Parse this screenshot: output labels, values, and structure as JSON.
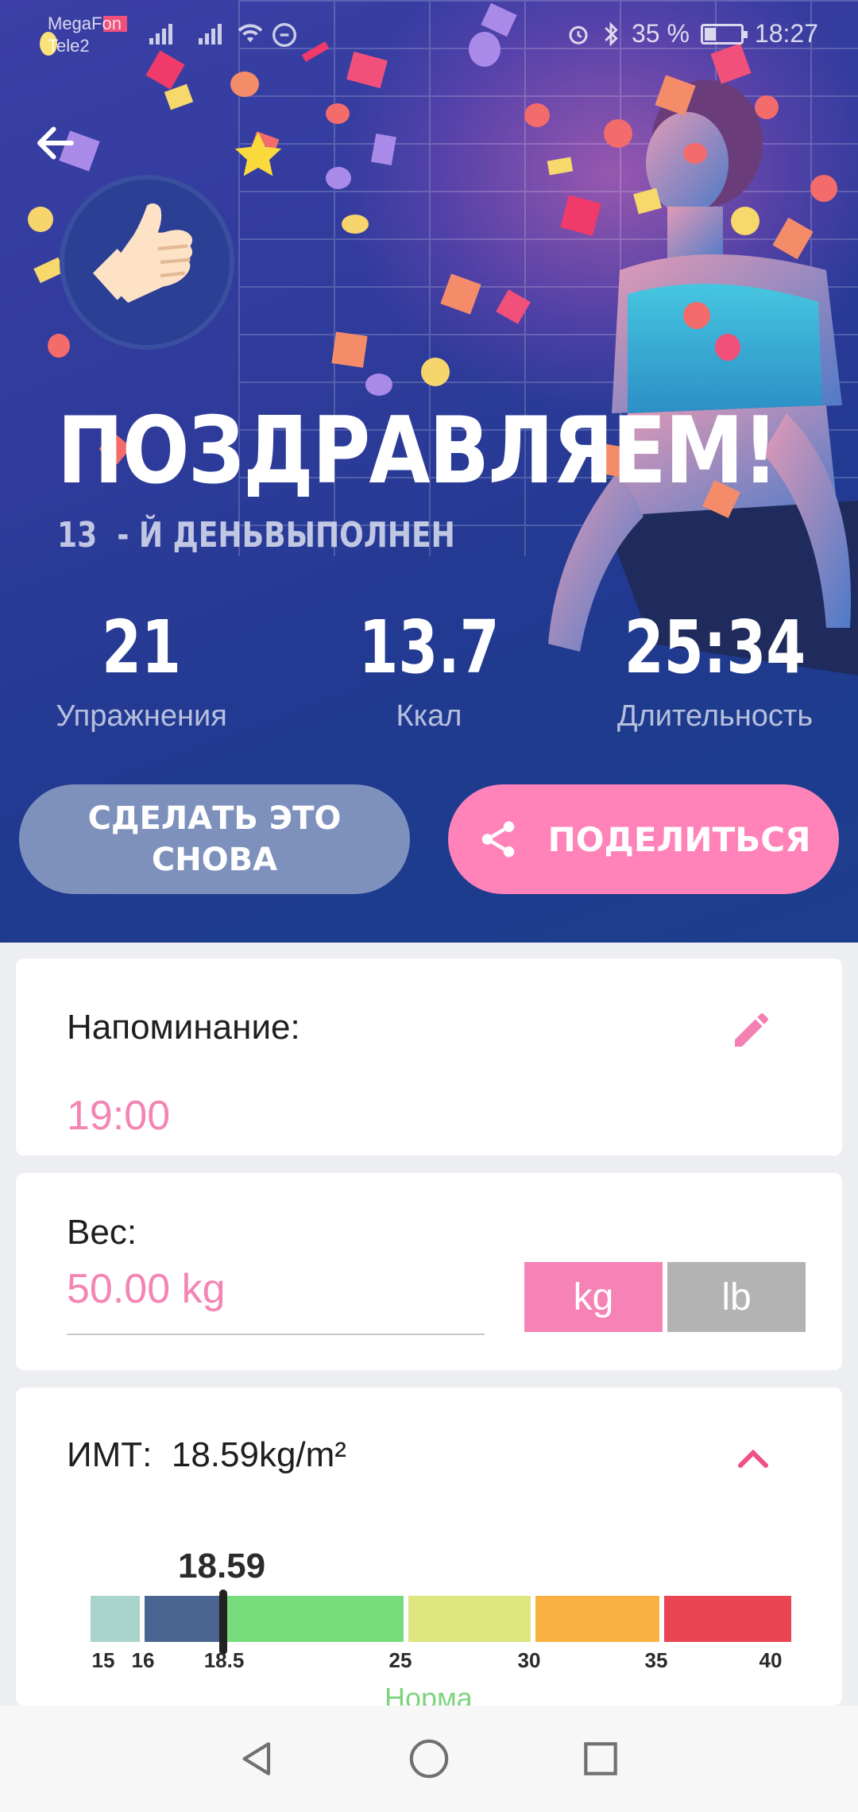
{
  "status_bar": {
    "carrier_1": "MegaFon",
    "carrier_2": "Tele2",
    "battery": "35 %",
    "time": "18:27"
  },
  "hero": {
    "title": "ПОЗДРАВЛЯЕМ!",
    "day_number": "13",
    "day_text": "- Й ДЕНЬВЫПОЛНЕН",
    "badge_icon": "thumbs-up-icon",
    "stats": [
      {
        "value": "21",
        "label": "Упражнения"
      },
      {
        "value": "13.7",
        "label": "Ккал"
      },
      {
        "value": "25:34",
        "label": "Длительность"
      }
    ],
    "again_label_1": "СДЕЛАТЬ ЭТО",
    "again_label_2": "СНОВА",
    "share_label": "ПОДЕЛИТЬСЯ"
  },
  "reminder": {
    "label": "Напоминание:",
    "time": "19:00"
  },
  "weight": {
    "label": "Вес:",
    "value": "50.00 kg",
    "unit_kg": "kg",
    "unit_lb": "lb"
  },
  "bmi": {
    "label": "ИМТ:",
    "value": "18.59kg/m²",
    "marker_value": "18.59",
    "status": "Норма",
    "ticks": [
      "15",
      "16",
      "18.5",
      "25",
      "30",
      "35",
      "40"
    ]
  },
  "colors": {
    "accent_pink": "#ff82b9",
    "text_pink": "#f484b4",
    "bmi_segments": [
      "#a9d3cb",
      "#4a6592",
      "#76db7a",
      "#dde67f",
      "#f8b041",
      "#ea4553"
    ]
  }
}
